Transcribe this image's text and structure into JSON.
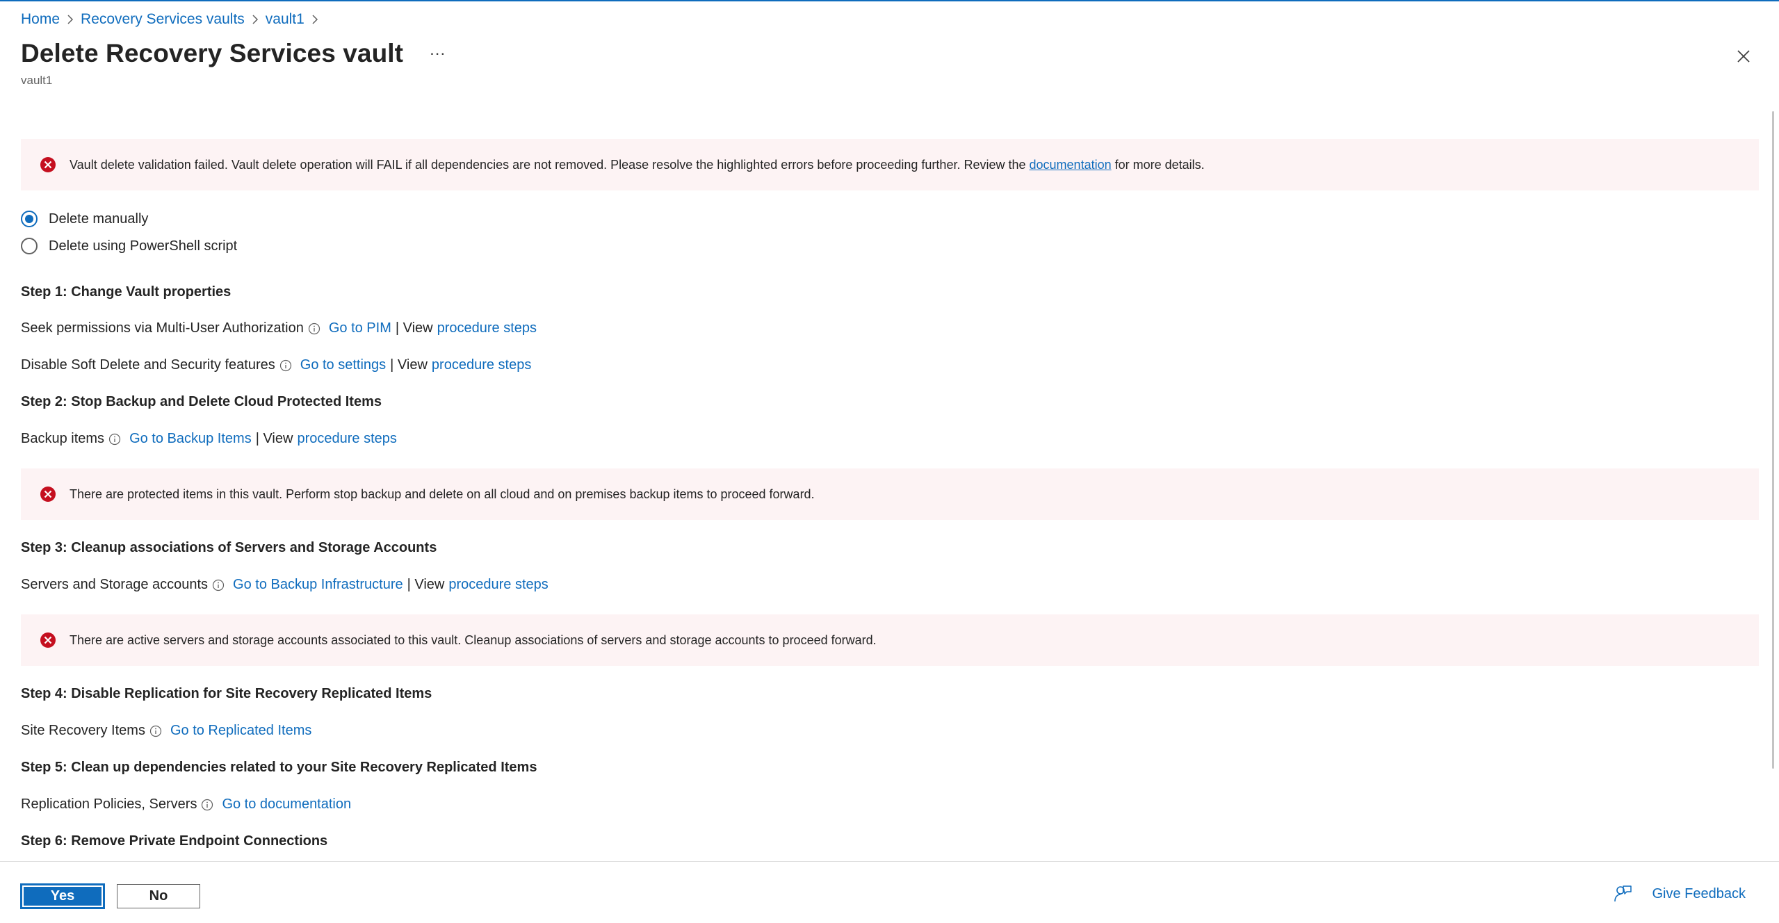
{
  "breadcrumb": {
    "items": [
      "Home",
      "Recovery Services vaults",
      "vault1"
    ]
  },
  "header": {
    "title": "Delete Recovery Services vault",
    "more": "...",
    "subtitle": "vault1"
  },
  "banners": {
    "validation": {
      "text_before": "Vault delete validation failed. Vault delete operation will FAIL if all dependencies are not removed. Please resolve the highlighted errors before proceeding further. Review the",
      "link": "documentation",
      "text_after": "for more details."
    },
    "protected_items": "There are protected items in this vault. Perform stop backup and delete on all cloud and on premises backup items to proceed forward.",
    "servers": "There are active servers and storage accounts associated to this vault. Cleanup associations of servers and storage accounts to proceed forward."
  },
  "delete_options": {
    "manual": "Delete manually",
    "powershell": "Delete using PowerShell script",
    "selected": "manual"
  },
  "steps": {
    "step1": {
      "heading": "Step 1: Change Vault properties",
      "row1": {
        "label": "Seek permissions via Multi-User Authorization",
        "link": "Go to PIM",
        "sep": "| View",
        "steps_link": "procedure steps"
      },
      "row2": {
        "label": "Disable Soft Delete and Security features",
        "link": "Go to settings",
        "sep": "| View",
        "steps_link": "procedure steps"
      }
    },
    "step2": {
      "heading": "Step 2: Stop Backup and Delete Cloud Protected Items",
      "row1": {
        "label": "Backup items",
        "link": "Go to Backup Items",
        "sep": "| View",
        "steps_link": "procedure steps"
      }
    },
    "step3": {
      "heading": "Step 3: Cleanup associations of Servers and Storage Accounts",
      "row1": {
        "label": "Servers and Storage accounts",
        "link": "Go to Backup Infrastructure",
        "sep": "| View",
        "steps_link": "procedure steps"
      }
    },
    "step4": {
      "heading": "Step 4: Disable Replication for Site Recovery Replicated Items",
      "row1": {
        "label": "Site Recovery Items",
        "link": "Go to Replicated Items"
      }
    },
    "step5": {
      "heading": "Step 5: Clean up dependencies related to your Site Recovery Replicated Items",
      "row1": {
        "label": "Replication Policies, Servers",
        "link": "Go to documentation"
      }
    },
    "step6": {
      "heading": "Step 6: Remove Private Endpoint Connections"
    }
  },
  "footer": {
    "yes": "Yes",
    "no": "No",
    "feedback": "Give Feedback"
  },
  "colors": {
    "accent": "#0f6cbd",
    "error": "#c50f1f",
    "error_bg": "#fdf3f4"
  }
}
